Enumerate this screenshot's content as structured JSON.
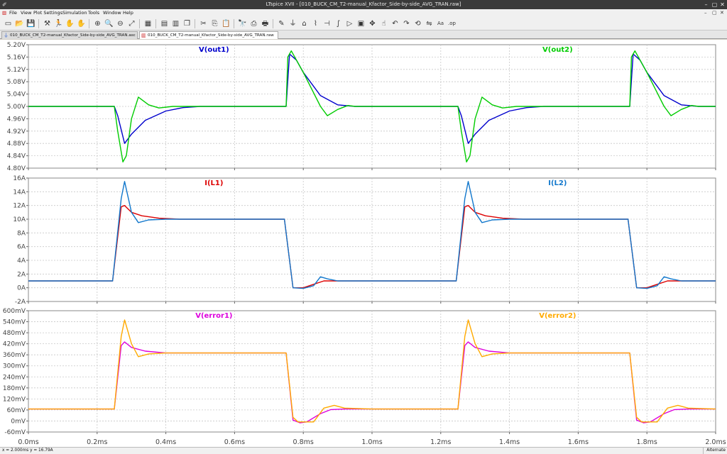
{
  "window": {
    "title": "LTspice XVII - [010_BUCK_CM_T2-manual_Kfactor_Side-by-side_AVG_TRAN.raw]",
    "controls": [
      "–",
      "▢",
      "✕"
    ]
  },
  "menu": {
    "items": [
      "File",
      "View",
      "Plot Settings",
      "Simulation",
      "Tools",
      "Window",
      "Help"
    ],
    "mdi_controls": [
      "–",
      "▢",
      "✕"
    ]
  },
  "toolbar": {
    "icons": [
      "new-schematic-icon",
      "open-icon",
      "save-icon",
      "sep",
      "control-panel-icon",
      "run-icon",
      "halt-icon",
      "pan-hand-icon",
      "sep",
      "zoom-in-icon",
      "zoom-box-icon",
      "zoom-out-icon",
      "zoom-fit-icon",
      "sep",
      "autorange-icon",
      "sep",
      "tile-vertical-icon",
      "tile-horizontal-icon",
      "cascade-icon",
      "sep",
      "cut-icon",
      "copy-icon",
      "paste-icon",
      "sep",
      "find-icon",
      "print-icon",
      "print-preview-icon",
      "sep",
      "draw-wire-icon",
      "ground-icon",
      "label-net-icon",
      "resistor-icon",
      "capacitor-icon",
      "inductor-icon",
      "diode-icon",
      "component-icon",
      "move-icon",
      "drag-icon",
      "undo-icon",
      "redo-icon",
      "rotate-icon",
      "mirror-icon",
      "text-icon",
      "spice-directive-icon"
    ]
  },
  "tabs": [
    {
      "label": "010_BUCK_CM_T2-manual_Kfactor_Side-by-side_AVG_TRAN.asc",
      "active": false
    },
    {
      "label": "010_BUCK_CM_T2-manual_Kfactor_Side-by-side_AVG_TRAN.raw",
      "active": true
    }
  ],
  "status": {
    "coords": "x = 2.000ms   y = 16.79A",
    "mode": "Alternate"
  },
  "chart_data": {
    "type": "line",
    "xlabel": "",
    "xlim": [
      0,
      2.0
    ],
    "x_unit": "ms",
    "x_ticks": [
      "0.0ms",
      "0.2ms",
      "0.4ms",
      "0.6ms",
      "0.8ms",
      "1.0ms",
      "1.2ms",
      "1.4ms",
      "1.6ms",
      "1.8ms",
      "2.0ms"
    ],
    "grid": true,
    "panes": [
      {
        "ylim": [
          4.8,
          5.2
        ],
        "y_ticks": [
          "5.20V",
          "5.16V",
          "5.12V",
          "5.08V",
          "5.04V",
          "5.00V",
          "4.96V",
          "4.92V",
          "4.88V",
          "4.84V",
          "4.80V"
        ],
        "series": [
          {
            "name": "V(out1)",
            "color": "#0000cc",
            "label_pos": 0.27,
            "x": [
              0,
              0.25,
              0.26,
              0.28,
              0.3,
              0.34,
              0.4,
              0.45,
              0.5,
              0.75,
              0.76,
              0.78,
              0.8,
              0.85,
              0.9,
              0.95,
              1.25,
              1.26,
              1.28,
              1.3,
              1.34,
              1.4,
              1.45,
              1.5,
              1.75,
              1.76,
              1.78,
              1.8,
              1.85,
              1.9,
              1.95,
              2.0
            ],
            "y": [
              5.0,
              5.0,
              4.97,
              4.88,
              4.91,
              4.955,
              4.985,
              4.996,
              5.0,
              5.0,
              5.17,
              5.15,
              5.11,
              5.035,
              5.005,
              5.0,
              5.0,
              4.97,
              4.88,
              4.91,
              4.955,
              4.985,
              4.996,
              5.0,
              5.0,
              5.17,
              5.15,
              5.11,
              5.035,
              5.005,
              5.0,
              5.0
            ]
          },
          {
            "name": "V(out2)",
            "color": "#00cc00",
            "label_pos": 0.77,
            "x": [
              0,
              0.25,
              0.26,
              0.275,
              0.285,
              0.3,
              0.32,
              0.35,
              0.38,
              0.42,
              0.5,
              0.75,
              0.755,
              0.765,
              0.8,
              0.85,
              0.87,
              0.9,
              0.93,
              0.95,
              1.25,
              1.26,
              1.275,
              1.285,
              1.3,
              1.32,
              1.35,
              1.38,
              1.42,
              1.5,
              1.75,
              1.755,
              1.765,
              1.8,
              1.85,
              1.87,
              1.9,
              1.93,
              1.95,
              2.0
            ],
            "y": [
              5.0,
              5.0,
              4.92,
              4.82,
              4.84,
              4.96,
              5.03,
              5.005,
              4.995,
              5.0,
              5.0,
              5.0,
              5.16,
              5.18,
              5.11,
              5.0,
              4.97,
              4.99,
              5.003,
              5.0,
              5.0,
              4.92,
              4.82,
              4.84,
              4.96,
              5.03,
              5.005,
              4.995,
              5.0,
              5.0,
              5.0,
              5.16,
              5.18,
              5.11,
              5.0,
              4.97,
              4.99,
              5.003,
              5.0,
              5.0
            ]
          }
        ]
      },
      {
        "ylim": [
          -2,
          16
        ],
        "y_ticks": [
          "16A",
          "14A",
          "12A",
          "10A",
          "8A",
          "6A",
          "4A",
          "2A",
          "0A",
          "-2A"
        ],
        "series": [
          {
            "name": "I(L1)",
            "color": "#dd0000",
            "label_pos": 0.27,
            "x": [
              0,
              0.245,
              0.27,
              0.28,
              0.3,
              0.33,
              0.38,
              0.44,
              0.745,
              0.77,
              0.8,
              0.83,
              0.86,
              0.89,
              0.95,
              1.0,
              1.245,
              1.27,
              1.28,
              1.3,
              1.33,
              1.38,
              1.44,
              1.745,
              1.77,
              1.8,
              1.83,
              1.86,
              1.89,
              1.95,
              2.0
            ],
            "y": [
              1,
              1,
              11.8,
              12.0,
              11.0,
              10.5,
              10.15,
              10,
              10,
              0,
              0,
              0.5,
              1.0,
              1.0,
              1.0,
              1.0,
              1,
              11.8,
              12.0,
              11.0,
              10.5,
              10.15,
              10,
              10,
              0,
              0,
              0.5,
              1.0,
              1.0,
              1.0,
              1.0
            ]
          },
          {
            "name": "I(L2)",
            "color": "#1177cc",
            "label_pos": 0.77,
            "x": [
              0,
              0.245,
              0.27,
              0.28,
              0.3,
              0.32,
              0.35,
              0.4,
              0.745,
              0.77,
              0.8,
              0.83,
              0.85,
              0.87,
              0.9,
              1.0,
              1.245,
              1.27,
              1.28,
              1.3,
              1.32,
              1.35,
              1.4,
              1.745,
              1.77,
              1.8,
              1.83,
              1.85,
              1.87,
              1.9,
              2.0
            ],
            "y": [
              1,
              1,
              13,
              15.5,
              11,
              9.5,
              9.9,
              10,
              10,
              0,
              -0.1,
              0.3,
              1.6,
              1.3,
              1.0,
              1.0,
              1,
              13,
              15.5,
              11,
              9.5,
              9.9,
              10,
              10,
              0,
              -0.1,
              0.3,
              1.6,
              1.3,
              1.0,
              1.0
            ]
          }
        ]
      },
      {
        "ylim": [
          -60,
          600
        ],
        "y_ticks": [
          "600mV",
          "540mV",
          "480mV",
          "420mV",
          "360mV",
          "300mV",
          "240mV",
          "180mV",
          "120mV",
          "60mV",
          "0mV",
          "-60mV"
        ],
        "series": [
          {
            "name": "V(error1)",
            "color": "#dd00dd",
            "label_pos": 0.27,
            "x": [
              0,
              0.25,
              0.27,
              0.28,
              0.3,
              0.34,
              0.4,
              0.75,
              0.77,
              0.79,
              0.81,
              0.85,
              0.88,
              0.92,
              1.0,
              1.25,
              1.27,
              1.28,
              1.3,
              1.34,
              1.4,
              1.75,
              1.77,
              1.79,
              1.81,
              1.85,
              1.88,
              1.92,
              2.0
            ],
            "y": [
              65,
              65,
              410,
              430,
              400,
              380,
              370,
              370,
              5,
              -10,
              -5,
              40,
              62,
              65,
              65,
              65,
              410,
              430,
              400,
              380,
              370,
              370,
              5,
              -10,
              -5,
              40,
              62,
              65,
              65
            ]
          },
          {
            "name": "V(error2)",
            "color": "#ffaa00",
            "label_pos": 0.77,
            "x": [
              0,
              0.25,
              0.27,
              0.28,
              0.3,
              0.32,
              0.35,
              0.4,
              0.75,
              0.77,
              0.785,
              0.8,
              0.83,
              0.86,
              0.89,
              0.92,
              1.0,
              1.25,
              1.27,
              1.28,
              1.3,
              1.32,
              1.35,
              1.4,
              1.75,
              1.77,
              1.785,
              1.8,
              1.83,
              1.86,
              1.89,
              1.92,
              2.0
            ],
            "y": [
              65,
              65,
              460,
              550,
              420,
              350,
              365,
              370,
              370,
              20,
              -5,
              -5,
              -5,
              70,
              85,
              70,
              65,
              65,
              460,
              550,
              420,
              350,
              365,
              370,
              370,
              20,
              -5,
              -5,
              -5,
              70,
              85,
              70,
              65
            ]
          }
        ]
      }
    ]
  }
}
